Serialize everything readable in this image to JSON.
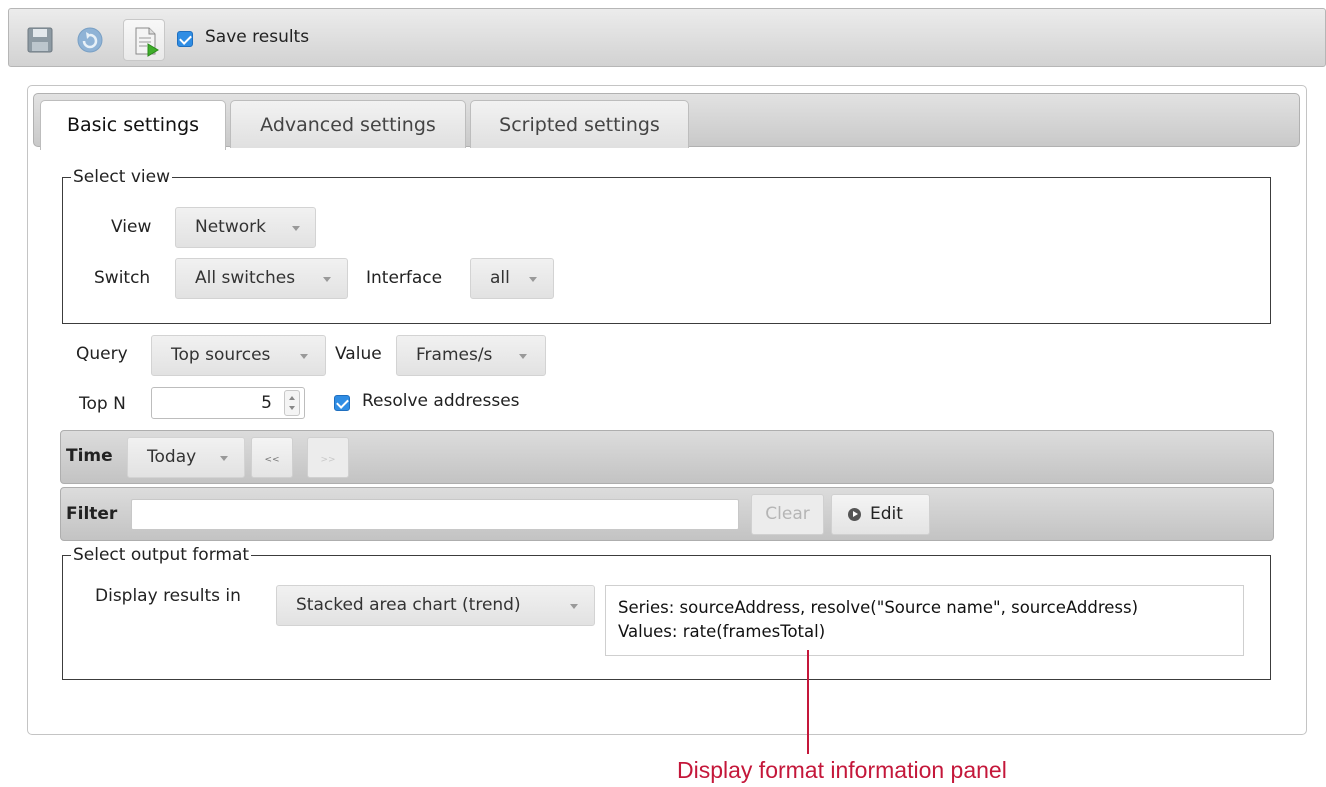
{
  "toolbar": {
    "save_results_label": "Save results",
    "save_results_checked": true
  },
  "tabs": [
    {
      "label": "Basic settings",
      "active": true
    },
    {
      "label": "Advanced settings",
      "active": false
    },
    {
      "label": "Scripted settings",
      "active": false
    }
  ],
  "select_view": {
    "legend": "Select view",
    "view_label": "View",
    "view_value": "Network",
    "switch_label": "Switch",
    "switch_value": "All switches",
    "interface_label": "Interface",
    "interface_value": "all"
  },
  "query": {
    "query_label": "Query",
    "query_value": "Top sources",
    "value_label": "Value",
    "value_value": "Frames/s",
    "topn_label": "Top N",
    "topn_value": "5",
    "resolve_label": "Resolve addresses",
    "resolve_checked": true
  },
  "time_bar": {
    "label": "Time",
    "value": "Today",
    "prev_icon": "rewind-icon",
    "next_icon": "fast-forward-icon"
  },
  "filter_bar": {
    "label": "Filter",
    "input_value": "",
    "clear_label": "Clear",
    "edit_label": "Edit"
  },
  "output": {
    "legend": "Select output format",
    "display_label": "Display results in",
    "display_value": "Stacked area chart (trend)",
    "info_series": "Series: sourceAddress, resolve(\"Source name\", sourceAddress)",
    "info_values": "Values: rate(framesTotal)"
  },
  "annotation": {
    "label": "Display format information panel",
    "color": "#c4173a"
  }
}
